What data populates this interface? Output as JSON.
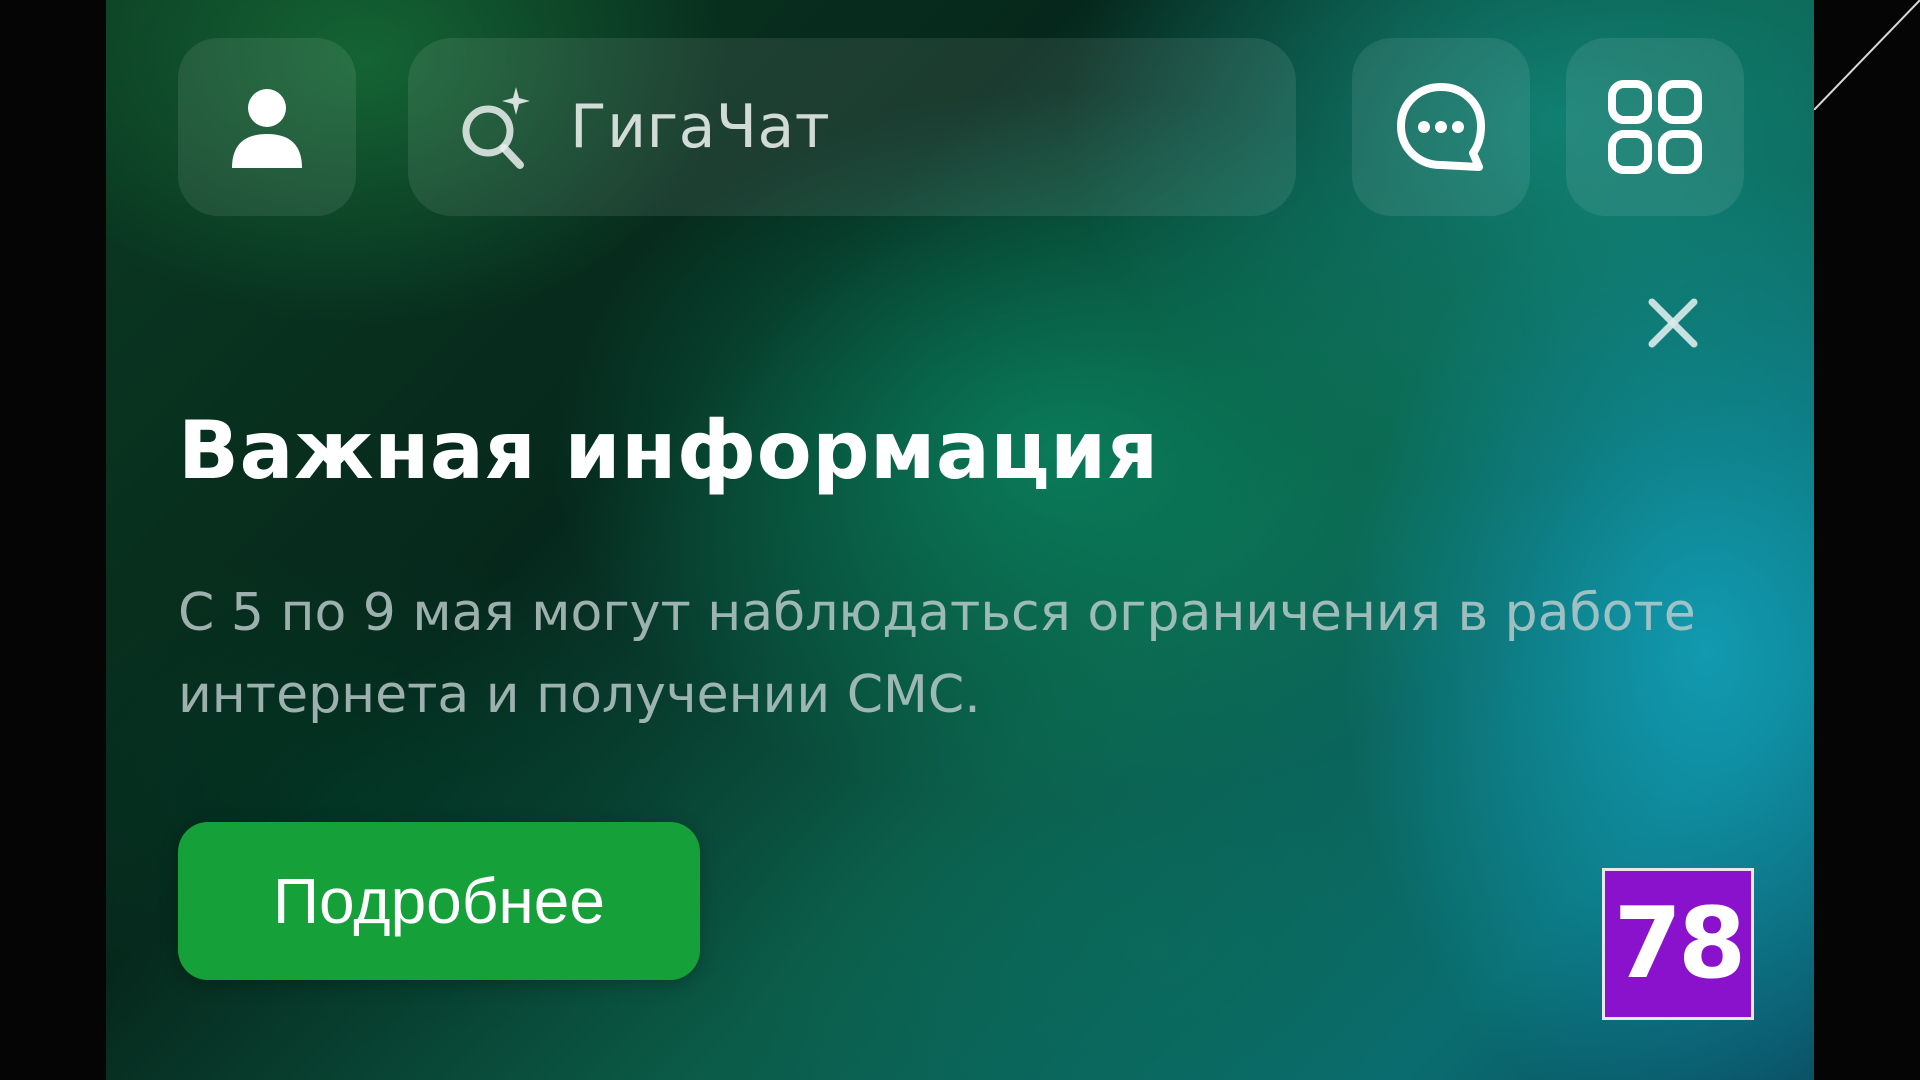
{
  "top_bar": {
    "profile_icon": "user-icon",
    "search": {
      "icon": "ai-search-sparkle-icon",
      "label": "ГигаЧат"
    },
    "chat_icon": "chat-bubble-icon",
    "apps_icon": "grid-apps-icon"
  },
  "banner": {
    "close_icon": "close-icon",
    "title": "Важная информация",
    "message": "С 5 по 9 мая могут наблюдаться ограничения в работе интернета и получении СМС.",
    "button_label": "Подробнее"
  },
  "watermark": {
    "text": "78"
  },
  "colors": {
    "button_green": "#16a03a",
    "logo_purple": "#8a12cc"
  }
}
